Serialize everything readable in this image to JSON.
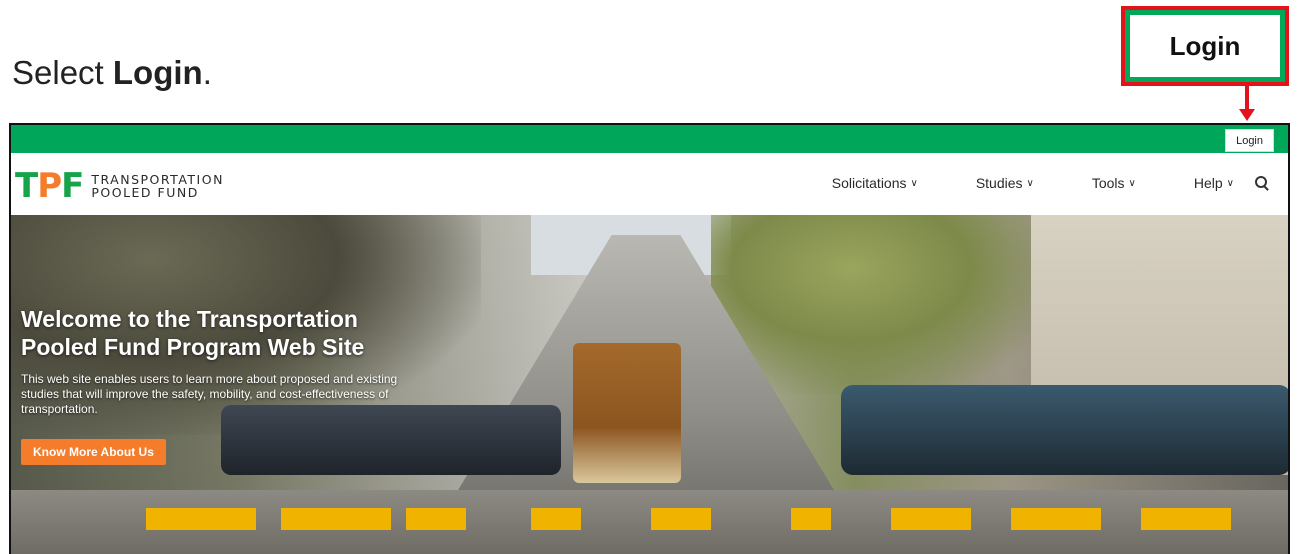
{
  "instruction": {
    "prefix": "Select ",
    "bold": "Login",
    "suffix": "."
  },
  "callout": {
    "label": "Login",
    "border_color": "#e3131b",
    "accent_color": "#00a857"
  },
  "site": {
    "topbar": {
      "login_label": "Login",
      "color": "#00a65a"
    },
    "logo": {
      "mark_t": "T",
      "mark_p": "P",
      "mark_f": "F",
      "line1": "TRANSPORTATION",
      "line2": "POOLED FUND"
    },
    "nav": [
      {
        "label": "Solicitations"
      },
      {
        "label": "Studies"
      },
      {
        "label": "Tools"
      },
      {
        "label": "Help"
      }
    ],
    "hero": {
      "title": "Welcome to the Transportation Pooled Fund Program Web Site",
      "text": "This web site enables users to learn more about proposed and existing studies that will improve the safety, mobility, and cost-effectiveness of transportation.",
      "button_label": "Know More About Us",
      "button_color": "#f47c2a"
    }
  }
}
